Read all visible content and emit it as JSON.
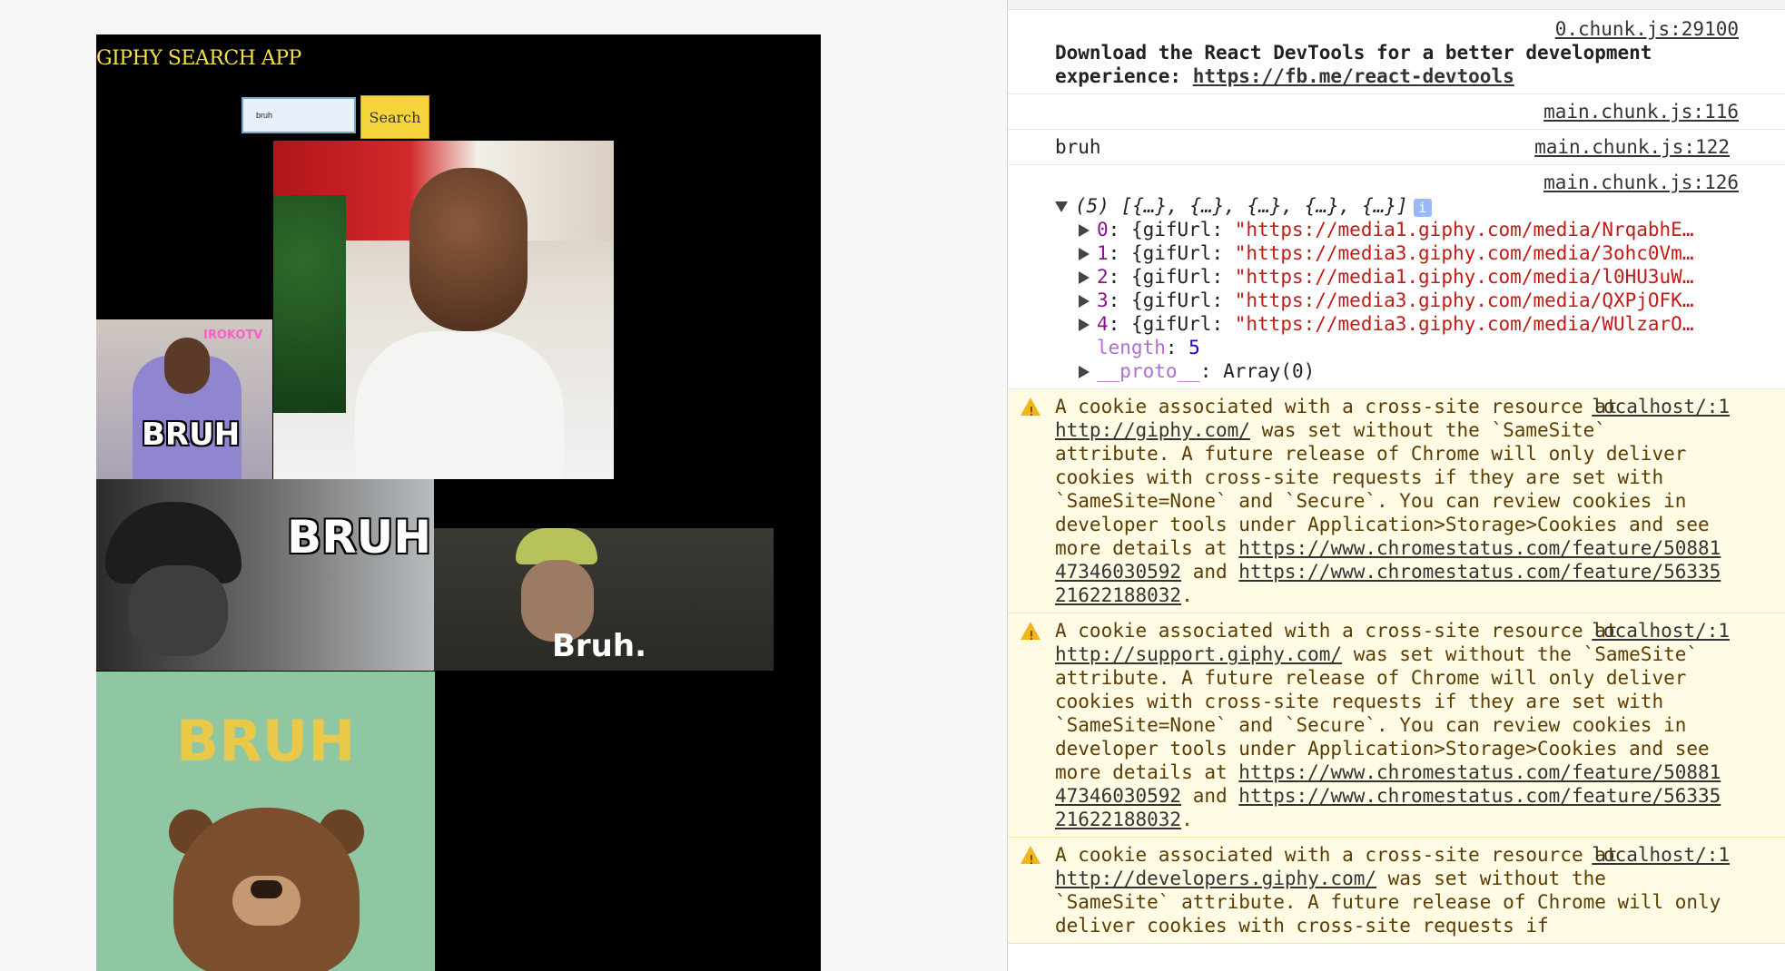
{
  "app": {
    "title": "GIPHY SEARCH APP",
    "search_value": "bruh",
    "search_button_label": "Search",
    "gifs": [
      {
        "caption": ""
      },
      {
        "caption": "BRUH",
        "logo": "IROKOTV"
      },
      {
        "caption": "BRUH"
      },
      {
        "caption": "Bruh."
      },
      {
        "caption": "BRUH"
      }
    ]
  },
  "console": {
    "messages": [
      {
        "type": "log",
        "source": "0.chunk.js:29100",
        "text_prefix": "Download the React DevTools for a better development experience: ",
        "link": "https://fb.me/react-devtools"
      },
      {
        "type": "log",
        "source": "main.chunk.js:116",
        "text": ""
      },
      {
        "type": "log",
        "source": "main.chunk.js:122",
        "text": "bruh"
      },
      {
        "type": "log",
        "source": "main.chunk.js:126",
        "array_summary": "(5) [{…}, {…}, {…}, {…}, {…}]",
        "array_items": [
          {
            "index": "0",
            "key": "gifUrl",
            "value": "\"https://media1.giphy.com/media/NrqabhE…"
          },
          {
            "index": "1",
            "key": "gifUrl",
            "value": "\"https://media3.giphy.com/media/3ohc0Vm…"
          },
          {
            "index": "2",
            "key": "gifUrl",
            "value": "\"https://media1.giphy.com/media/l0HU3uW…"
          },
          {
            "index": "3",
            "key": "gifUrl",
            "value": "\"https://media3.giphy.com/media/QXPjOFK…"
          },
          {
            "index": "4",
            "key": "gifUrl",
            "value": "\"https://media3.giphy.com/media/WUlzarO…"
          }
        ],
        "length_label": "length",
        "length_value": "5",
        "proto_label": "__proto__",
        "proto_value": "Array(0)"
      }
    ],
    "warnings": [
      {
        "source": "localhost/:1",
        "pre": "A cookie associated with a cross-site resource at ",
        "link": "http://giphy.com/",
        "body": " was set without the `SameSite` attribute. A future release of Chrome will only deliver cookies with cross-site requests if they are set with `SameSite=None` and `Secure`. You can review cookies in developer tools under Application>Storage>Cookies and see more details at ",
        "link2": "https://www.chromestatus.com/feature/5088147346030592",
        "and": " and ",
        "link3": "https://www.chromestatus.com/feature/5633521622188032",
        "end": "."
      },
      {
        "source": "localhost/:1",
        "pre": "A cookie associated with a cross-site resource at ",
        "link": "http://support.giphy.com/",
        "body": " was set without the `SameSite` attribute. A future release of Chrome will only deliver cookies with cross-site requests if they are set with `SameSite=None` and `Secure`. You can review cookies in developer tools under Application>Storage>Cookies and see more details at ",
        "link2": "https://www.chromestatus.com/feature/5088147346030592",
        "and": " and ",
        "link3": "https://www.chromestatus.com/feature/5633521622188032",
        "end": "."
      },
      {
        "source": "localhost/:1",
        "pre": "A cookie associated with a cross-site resource at ",
        "link": "http://developers.giphy.com/",
        "body": " was set without the `SameSite` attribute. A future release of Chrome will only deliver cookies with cross-site requests if",
        "link2": "",
        "and": "",
        "link3": "",
        "end": ""
      }
    ]
  },
  "colors": {
    "title": "#f5e04a",
    "search_button": "#f8d43c",
    "warning_bg": "#fffbe5",
    "url": "#c41a16"
  }
}
